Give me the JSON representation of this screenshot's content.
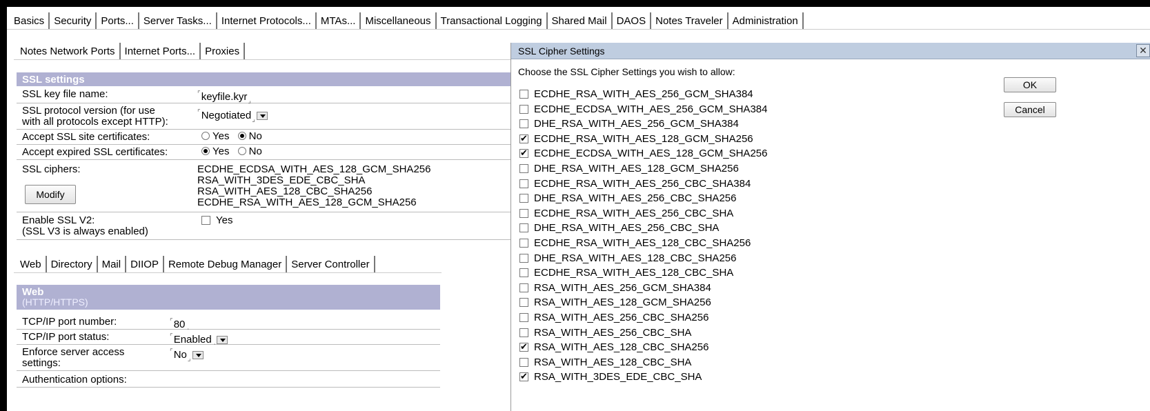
{
  "main_tabs": [
    "Basics",
    "Security",
    "Ports...",
    "Server Tasks...",
    "Internet Protocols...",
    "MTAs...",
    "Miscellaneous",
    "Transactional Logging",
    "Shared Mail",
    "DAOS",
    "Notes Traveler",
    "Administration"
  ],
  "port_tabs": [
    "Notes Network Ports",
    "Internet Ports...",
    "Proxies"
  ],
  "ssl": {
    "header": "SSL settings",
    "key_file_label": "SSL key file name:",
    "key_file_value": "keyfile.kyr",
    "protocol_label_1": "SSL protocol version (for use",
    "protocol_label_2": "with all protocols except HTTP):",
    "protocol_value": "Negotiated",
    "accept_site_label": "Accept SSL site certificates:",
    "accept_expired_label": "Accept expired SSL certificates:",
    "yes": "Yes",
    "no": "No",
    "ciphers_label": "SSL ciphers:",
    "modify_label": "Modify",
    "ciphers": [
      "ECDHE_ECDSA_WITH_AES_128_GCM_SHA256",
      "RSA_WITH_3DES_EDE_CBC_SHA",
      "RSA_WITH_AES_128_CBC_SHA256",
      "ECDHE_RSA_WITH_AES_128_GCM_SHA256"
    ],
    "v2_label_1": "Enable SSL V2:",
    "v2_label_2": "(SSL V3 is always enabled)",
    "v2_value": "Yes"
  },
  "protocol_tabs": [
    "Web",
    "Directory",
    "Mail",
    "DIIOP",
    "Remote Debug Manager",
    "Server Controller"
  ],
  "web": {
    "header": "Web",
    "subheader": "(HTTP/HTTPS)",
    "port_number_label": "TCP/IP port number:",
    "port_number_value": "80",
    "port_status_label": "TCP/IP port status:",
    "port_status_value": "Enabled",
    "enforce_label_1": "Enforce server access",
    "enforce_label_2": "settings:",
    "enforce_value": "No",
    "auth_label": "Authentication options:"
  },
  "dialog": {
    "title": "SSL Cipher Settings",
    "close": "✕",
    "prompt": "Choose the SSL Cipher Settings you wish to allow:",
    "ok_label": "OK",
    "cancel_label": "Cancel",
    "ciphers": [
      {
        "name": "ECDHE_RSA_WITH_AES_256_GCM_SHA384",
        "checked": false
      },
      {
        "name": "ECDHE_ECDSA_WITH_AES_256_GCM_SHA384",
        "checked": false
      },
      {
        "name": "DHE_RSA_WITH_AES_256_GCM_SHA384",
        "checked": false
      },
      {
        "name": "ECDHE_RSA_WITH_AES_128_GCM_SHA256",
        "checked": true
      },
      {
        "name": "ECDHE_ECDSA_WITH_AES_128_GCM_SHA256",
        "checked": true
      },
      {
        "name": "DHE_RSA_WITH_AES_128_GCM_SHA256",
        "checked": false
      },
      {
        "name": "ECDHE_RSA_WITH_AES_256_CBC_SHA384",
        "checked": false
      },
      {
        "name": "DHE_RSA_WITH_AES_256_CBC_SHA256",
        "checked": false
      },
      {
        "name": "ECDHE_RSA_WITH_AES_256_CBC_SHA",
        "checked": false
      },
      {
        "name": "DHE_RSA_WITH_AES_256_CBC_SHA",
        "checked": false
      },
      {
        "name": "ECDHE_RSA_WITH_AES_128_CBC_SHA256",
        "checked": false
      },
      {
        "name": "DHE_RSA_WITH_AES_128_CBC_SHA256",
        "checked": false
      },
      {
        "name": "ECDHE_RSA_WITH_AES_128_CBC_SHA",
        "checked": false
      },
      {
        "name": "RSA_WITH_AES_256_GCM_SHA384",
        "checked": false
      },
      {
        "name": "RSA_WITH_AES_128_GCM_SHA256",
        "checked": false
      },
      {
        "name": "RSA_WITH_AES_256_CBC_SHA256",
        "checked": false
      },
      {
        "name": "RSA_WITH_AES_256_CBC_SHA",
        "checked": false
      },
      {
        "name": "RSA_WITH_AES_128_CBC_SHA256",
        "checked": true
      },
      {
        "name": "RSA_WITH_AES_128_CBC_SHA",
        "checked": false
      },
      {
        "name": "RSA_WITH_3DES_EDE_CBC_SHA",
        "checked": true
      }
    ]
  },
  "colors": {
    "section_header": "#b0b1d2",
    "dialog_title": "#bfcde0"
  }
}
